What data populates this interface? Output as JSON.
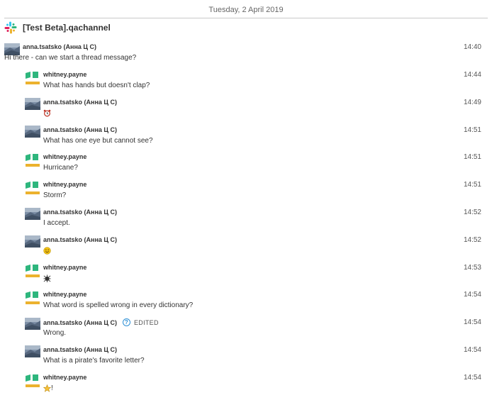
{
  "date": "Tuesday, 2 April 2019",
  "channel": {
    "name": "[Test Beta].qachannel",
    "icon": "slack-logo-icon"
  },
  "root_message": {
    "user": "anna.tsatsko (Анна Ц С)",
    "text": "Hi there - can we start a thread message?",
    "time": "14:40"
  },
  "replies": [
    {
      "user": "whitney.payne",
      "avatar": "whitney",
      "text": "What has hands but doesn't clap?",
      "time": "14:44"
    },
    {
      "user": "anna.tsatsko (Анна Ц С)",
      "avatar": "anna",
      "text": "",
      "emoji": "alarm-clock-icon",
      "time": "14:49"
    },
    {
      "user": "anna.tsatsko (Анна Ц С)",
      "avatar": "anna",
      "text": "What has one eye but cannot see?",
      "time": "14:51"
    },
    {
      "user": "whitney.payne",
      "avatar": "whitney",
      "text": "Hurricane?",
      "time": "14:51"
    },
    {
      "user": "whitney.payne",
      "avatar": "whitney",
      "text": "Storm?",
      "time": "14:51"
    },
    {
      "user": "anna.tsatsko (Анна Ц С)",
      "avatar": "anna",
      "text": "I accept.",
      "time": "14:52"
    },
    {
      "user": "anna.tsatsko (Анна Ц С)",
      "avatar": "anna",
      "text": "",
      "emoji": "smiley-face-icon",
      "time": "14:52"
    },
    {
      "user": "whitney.payne",
      "avatar": "whitney",
      "text": "",
      "emoji": "gear-bug-icon",
      "time": "14:53"
    },
    {
      "user": "whitney.payne",
      "avatar": "whitney",
      "text": "What word is spelled wrong in every dictionary?",
      "time": "14:54"
    },
    {
      "user": "anna.tsatsko (Анна Ц С)",
      "avatar": "anna",
      "text": "Wrong.",
      "time": "14:54",
      "edited": "EDITED"
    },
    {
      "user": "anna.tsatsko (Анна Ц С)",
      "avatar": "anna",
      "text": "What is a pirate's favorite letter?",
      "time": "14:54"
    },
    {
      "user": "whitney.payne",
      "avatar": "whitney",
      "text": "!",
      "emoji": "star-icon",
      "time": "14:54"
    }
  ],
  "colors": {
    "whitney_green": "#2eb67d",
    "whitney_yellow": "#ecb22e",
    "edited_blue": "#2d8fd5"
  }
}
